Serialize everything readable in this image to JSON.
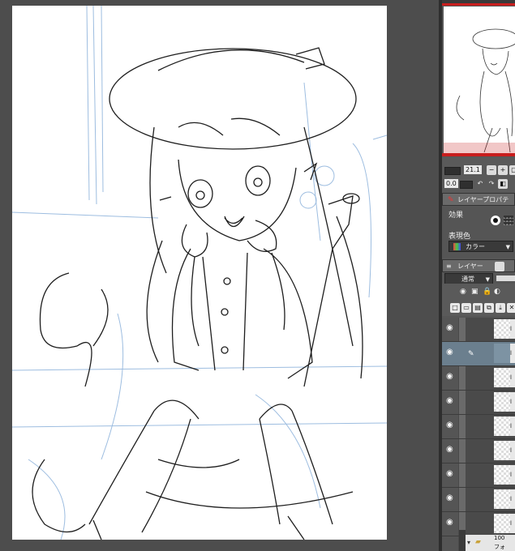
{
  "navigator": {
    "zoom_value": "21.1",
    "rotation_value": "0.0"
  },
  "tabs": {
    "layer_property": "レイヤープロパティ",
    "layer": "レイヤー"
  },
  "properties": {
    "effect_label": "効果",
    "color_label": "表現色",
    "color_value": "カラー"
  },
  "layer_panel": {
    "blend_mode": "通常",
    "opacity": "100",
    "folder_hint": "フォ"
  },
  "layers": [
    {
      "visible": true,
      "selected": false,
      "name_hint": "l"
    },
    {
      "visible": true,
      "selected": true,
      "name_hint": "l"
    },
    {
      "visible": true,
      "selected": false,
      "name_hint": "l"
    },
    {
      "visible": true,
      "selected": false,
      "name_hint": "l"
    },
    {
      "visible": true,
      "selected": false,
      "name_hint": "l"
    },
    {
      "visible": true,
      "selected": false,
      "name_hint": "l"
    },
    {
      "visible": true,
      "selected": false,
      "name_hint": "l"
    },
    {
      "visible": true,
      "selected": false,
      "name_hint": "l"
    },
    {
      "visible": true,
      "selected": false,
      "name_hint": "l"
    }
  ],
  "colors": {
    "accent_red": "#c81e1e",
    "selected_layer": "#6b7f8e",
    "sketch_blue": "#8fb3dc"
  },
  "icons": [
    "eye-icon",
    "zoom-in-icon",
    "zoom-out-icon",
    "rotate-left-icon",
    "rotate-right-icon",
    "pen-icon",
    "folder-icon",
    "new-layer-icon"
  ]
}
